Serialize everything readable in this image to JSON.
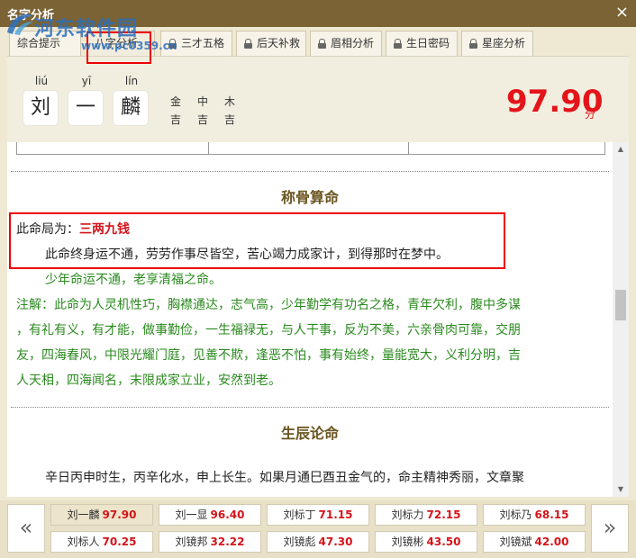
{
  "window": {
    "title": "名字分析",
    "close_label": "×"
  },
  "watermark": {
    "name": "河东软件园",
    "url": "www.pc0359.cn"
  },
  "tabs": [
    {
      "label": "综合提示",
      "locked": false,
      "active": false
    },
    {
      "label": "八字分析",
      "locked": false,
      "active": true
    },
    {
      "label": "三才五格",
      "locked": true,
      "active": false
    },
    {
      "label": "后天补救",
      "locked": true,
      "active": false
    },
    {
      "label": "眉相分析",
      "locked": true,
      "active": false
    },
    {
      "label": "生日密码",
      "locked": true,
      "active": false
    },
    {
      "label": "星座分析",
      "locked": true,
      "active": false
    }
  ],
  "name_chars": [
    {
      "pinyin": "liú",
      "char": "刘"
    },
    {
      "pinyin": "yī",
      "char": "一"
    },
    {
      "pinyin": "lín",
      "char": "麟"
    }
  ],
  "wuxing": [
    {
      "element": "金",
      "luck": "吉"
    },
    {
      "element": "中",
      "luck": "吉"
    },
    {
      "element": "木",
      "luck": "吉"
    }
  ],
  "score": {
    "value": "97.90",
    "unit": "分"
  },
  "sections": {
    "chenggu": {
      "title": "称骨算命",
      "fate_label": "此命局为：",
      "fate_value": "三两九钱",
      "fate_desc": "此命终身运不通，劳劳作事尽皆空，苦心竭力成家计，到得那时在梦中。",
      "fate_sub": "少年命运不通，老享清福之命。",
      "note_lines": [
        "注解：此命为人灵机性巧，胸襟通达，志气高，少年勤学有功名之格，青年欠利，腹中多谋",
        "，有礼有义，有才能，做事勤俭，一生福禄无，与人干事，反为不美，六亲骨肉可靠，交朋",
        "友，四海春风，中限光耀门庭，见善不欺，逢恶不怕，事有始终，量能宽大，义利分明，吉",
        "人天相，四海闻名，末限成家立业，安然到老。"
      ]
    },
    "shengchen": {
      "title": "生辰论命",
      "line1": "辛日丙申时生，丙辛化水，申上长生。如果月通巳酉丑金气的，命主精神秀丽，文章聚"
    }
  },
  "candidates": [
    {
      "name": "刘一麟",
      "score": "97.90",
      "selected": true
    },
    {
      "name": "刘一显",
      "score": "96.40",
      "selected": false
    },
    {
      "name": "刘标丁",
      "score": "71.15",
      "selected": false
    },
    {
      "name": "刘标力",
      "score": "72.15",
      "selected": false
    },
    {
      "name": "刘标乃",
      "score": "68.15",
      "selected": false
    },
    {
      "name": "刘标人",
      "score": "70.25",
      "selected": false
    },
    {
      "name": "刘镜邦",
      "score": "32.22",
      "selected": false
    },
    {
      "name": "刘镜彪",
      "score": "47.30",
      "selected": false
    },
    {
      "name": "刘镜彬",
      "score": "43.50",
      "selected": false
    },
    {
      "name": "刘镜斌",
      "score": "42.00",
      "selected": false
    }
  ],
  "nav": {
    "prev_label": "«",
    "next_label": "»"
  },
  "colors": {
    "titlebar": "#7b6335",
    "accent_red": "#e3141a",
    "note_green": "#2a8a1e",
    "section_title": "#6a5520"
  }
}
